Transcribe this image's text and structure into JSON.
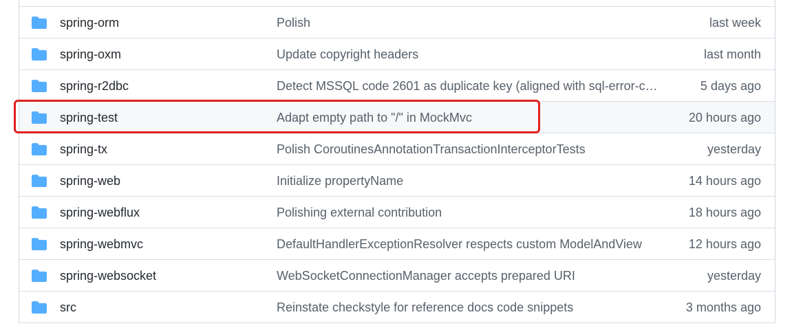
{
  "colors": {
    "folder": "#54aeff",
    "highlight": "#e02020",
    "hover_bg": "#f6f8fa"
  },
  "rows": [
    {
      "name": "spring-orm",
      "message": "Polish",
      "age": "last week",
      "icon": "folder-icon"
    },
    {
      "name": "spring-oxm",
      "message": "Update copyright headers",
      "age": "last month",
      "icon": "folder-icon"
    },
    {
      "name": "spring-r2dbc",
      "message": "Detect MSSQL code 2601 as duplicate key (aligned with sql-error-code...",
      "age": "5 days ago",
      "icon": "folder-icon"
    },
    {
      "name": "spring-test",
      "message": "Adapt empty path to \"/\" in MockMvc",
      "age": "20 hours ago",
      "icon": "folder-icon"
    },
    {
      "name": "spring-tx",
      "message": "Polish CoroutinesAnnotationTransactionInterceptorTests",
      "age": "yesterday",
      "icon": "folder-icon"
    },
    {
      "name": "spring-web",
      "message": "Initialize propertyName",
      "age": "14 hours ago",
      "icon": "folder-icon"
    },
    {
      "name": "spring-webflux",
      "message": "Polishing external contribution",
      "age": "18 hours ago",
      "icon": "folder-icon"
    },
    {
      "name": "spring-webmvc",
      "message": "DefaultHandlerExceptionResolver respects custom ModelAndView",
      "age": "12 hours ago",
      "icon": "folder-icon"
    },
    {
      "name": "spring-websocket",
      "message": "WebSocketConnectionManager accepts prepared URI",
      "age": "yesterday",
      "icon": "folder-icon"
    },
    {
      "name": "src",
      "message": "Reinstate checkstyle for reference docs code snippets",
      "age": "3 months ago",
      "icon": "folder-icon"
    }
  ]
}
